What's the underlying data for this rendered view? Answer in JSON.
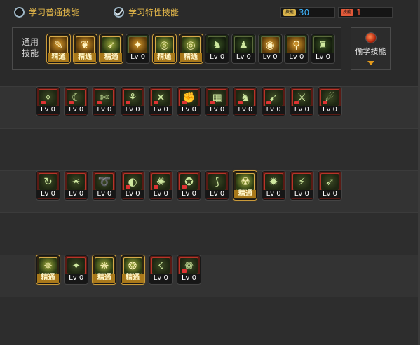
{
  "header": {
    "radio_normal": "学习普通技能",
    "radio_special": "学习特性技能",
    "counter_a": {
      "tag": "技能",
      "value": "30",
      "color": "#3fb6ff",
      "tag_color": "#d8b24a"
    },
    "counter_b": {
      "tag": "技能",
      "value": "1",
      "color": "#ff5a3a",
      "tag_color": "#e35a3a"
    }
  },
  "common": {
    "label": "通用技能",
    "skills": [
      {
        "glyph": "✎",
        "caption": "精通",
        "style": "gold goldart"
      },
      {
        "glyph": "❦",
        "caption": "精通",
        "style": "gold goldart"
      },
      {
        "glyph": "➶",
        "caption": "精通",
        "style": "gold"
      },
      {
        "glyph": "✦",
        "caption": "Lv 0",
        "style": "green goldart"
      },
      {
        "glyph": "◎",
        "caption": "精通",
        "style": "gold"
      },
      {
        "glyph": "◎",
        "caption": "精通",
        "style": "gold"
      },
      {
        "glyph": "♞",
        "caption": "Lv 0",
        "style": "green"
      },
      {
        "glyph": "♟",
        "caption": "Lv 0",
        "style": "green"
      },
      {
        "glyph": "◉",
        "caption": "Lv 0",
        "style": "green goldart"
      },
      {
        "glyph": "♀",
        "caption": "Lv 0",
        "style": "green goldart"
      },
      {
        "glyph": "♜",
        "caption": "Lv 0",
        "style": "green"
      }
    ]
  },
  "steal": {
    "label": "偷学技能"
  },
  "rows": [
    {
      "skills": [
        {
          "glyph": "✧",
          "caption": "Lv 0",
          "style": "red redmark"
        },
        {
          "glyph": "☾",
          "caption": "Lv 0",
          "style": "red redmark"
        },
        {
          "glyph": "✄",
          "caption": "Lv 0",
          "style": "red redmark"
        },
        {
          "glyph": "⚘",
          "caption": "Lv 0",
          "style": "red redmark"
        },
        {
          "glyph": "✕",
          "caption": "Lv 0",
          "style": "red redmark"
        },
        {
          "glyph": "✊",
          "caption": "Lv 0",
          "style": "red redmark"
        },
        {
          "glyph": "▦",
          "caption": "Lv 0",
          "style": "red redmark"
        },
        {
          "glyph": "♞",
          "caption": "Lv 0",
          "style": "red redmark"
        },
        {
          "glyph": "➹",
          "caption": "Lv 0",
          "style": "red redmark"
        },
        {
          "glyph": "⚔",
          "caption": "Lv 0",
          "style": "red redmark"
        },
        {
          "glyph": "☄",
          "caption": "Lv 0",
          "style": "red redmark"
        }
      ]
    },
    {
      "skills": [
        {
          "glyph": "↻",
          "caption": "Lv 0",
          "style": "red"
        },
        {
          "glyph": "✴",
          "caption": "Lv 0",
          "style": "red"
        },
        {
          "glyph": "➰",
          "caption": "Lv 0",
          "style": "red"
        },
        {
          "glyph": "◐",
          "caption": "Lv 0",
          "style": "red redmark"
        },
        {
          "glyph": "✺",
          "caption": "Lv 0",
          "style": "red redmark"
        },
        {
          "glyph": "✪",
          "caption": "Lv 0",
          "style": "red redmark"
        },
        {
          "glyph": "⟆",
          "caption": "Lv 0",
          "style": "red"
        },
        {
          "glyph": "☢",
          "caption": "精通",
          "style": "gold"
        },
        {
          "glyph": "✹",
          "caption": "Lv 0",
          "style": "red"
        },
        {
          "glyph": "⚡",
          "caption": "Lv 0",
          "style": "red"
        },
        {
          "glyph": "➶",
          "caption": "Lv 0",
          "style": "red"
        }
      ]
    },
    {
      "skills": [
        {
          "glyph": "✵",
          "caption": "精通",
          "style": "gold"
        },
        {
          "glyph": "✦",
          "caption": "Lv 0",
          "style": "red"
        },
        {
          "glyph": "❋",
          "caption": "精通",
          "style": "gold"
        },
        {
          "glyph": "❂",
          "caption": "精通",
          "style": "gold"
        },
        {
          "glyph": "☇",
          "caption": "Lv 0",
          "style": "red"
        },
        {
          "glyph": "❁",
          "caption": "Lv 0",
          "style": "red redmark"
        }
      ]
    }
  ]
}
